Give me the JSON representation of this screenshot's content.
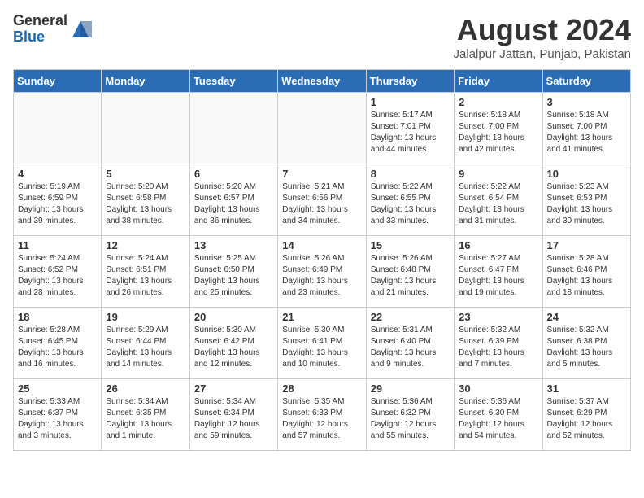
{
  "header": {
    "logo_general": "General",
    "logo_blue": "Blue",
    "month_title": "August 2024",
    "location": "Jalalpur Jattan, Punjab, Pakistan"
  },
  "weekdays": [
    "Sunday",
    "Monday",
    "Tuesday",
    "Wednesday",
    "Thursday",
    "Friday",
    "Saturday"
  ],
  "weeks": [
    [
      {
        "day": "",
        "info": ""
      },
      {
        "day": "",
        "info": ""
      },
      {
        "day": "",
        "info": ""
      },
      {
        "day": "",
        "info": ""
      },
      {
        "day": "1",
        "info": "Sunrise: 5:17 AM\nSunset: 7:01 PM\nDaylight: 13 hours\nand 44 minutes."
      },
      {
        "day": "2",
        "info": "Sunrise: 5:18 AM\nSunset: 7:00 PM\nDaylight: 13 hours\nand 42 minutes."
      },
      {
        "day": "3",
        "info": "Sunrise: 5:18 AM\nSunset: 7:00 PM\nDaylight: 13 hours\nand 41 minutes."
      }
    ],
    [
      {
        "day": "4",
        "info": "Sunrise: 5:19 AM\nSunset: 6:59 PM\nDaylight: 13 hours\nand 39 minutes."
      },
      {
        "day": "5",
        "info": "Sunrise: 5:20 AM\nSunset: 6:58 PM\nDaylight: 13 hours\nand 38 minutes."
      },
      {
        "day": "6",
        "info": "Sunrise: 5:20 AM\nSunset: 6:57 PM\nDaylight: 13 hours\nand 36 minutes."
      },
      {
        "day": "7",
        "info": "Sunrise: 5:21 AM\nSunset: 6:56 PM\nDaylight: 13 hours\nand 34 minutes."
      },
      {
        "day": "8",
        "info": "Sunrise: 5:22 AM\nSunset: 6:55 PM\nDaylight: 13 hours\nand 33 minutes."
      },
      {
        "day": "9",
        "info": "Sunrise: 5:22 AM\nSunset: 6:54 PM\nDaylight: 13 hours\nand 31 minutes."
      },
      {
        "day": "10",
        "info": "Sunrise: 5:23 AM\nSunset: 6:53 PM\nDaylight: 13 hours\nand 30 minutes."
      }
    ],
    [
      {
        "day": "11",
        "info": "Sunrise: 5:24 AM\nSunset: 6:52 PM\nDaylight: 13 hours\nand 28 minutes."
      },
      {
        "day": "12",
        "info": "Sunrise: 5:24 AM\nSunset: 6:51 PM\nDaylight: 13 hours\nand 26 minutes."
      },
      {
        "day": "13",
        "info": "Sunrise: 5:25 AM\nSunset: 6:50 PM\nDaylight: 13 hours\nand 25 minutes."
      },
      {
        "day": "14",
        "info": "Sunrise: 5:26 AM\nSunset: 6:49 PM\nDaylight: 13 hours\nand 23 minutes."
      },
      {
        "day": "15",
        "info": "Sunrise: 5:26 AM\nSunset: 6:48 PM\nDaylight: 13 hours\nand 21 minutes."
      },
      {
        "day": "16",
        "info": "Sunrise: 5:27 AM\nSunset: 6:47 PM\nDaylight: 13 hours\nand 19 minutes."
      },
      {
        "day": "17",
        "info": "Sunrise: 5:28 AM\nSunset: 6:46 PM\nDaylight: 13 hours\nand 18 minutes."
      }
    ],
    [
      {
        "day": "18",
        "info": "Sunrise: 5:28 AM\nSunset: 6:45 PM\nDaylight: 13 hours\nand 16 minutes."
      },
      {
        "day": "19",
        "info": "Sunrise: 5:29 AM\nSunset: 6:44 PM\nDaylight: 13 hours\nand 14 minutes."
      },
      {
        "day": "20",
        "info": "Sunrise: 5:30 AM\nSunset: 6:42 PM\nDaylight: 13 hours\nand 12 minutes."
      },
      {
        "day": "21",
        "info": "Sunrise: 5:30 AM\nSunset: 6:41 PM\nDaylight: 13 hours\nand 10 minutes."
      },
      {
        "day": "22",
        "info": "Sunrise: 5:31 AM\nSunset: 6:40 PM\nDaylight: 13 hours\nand 9 minutes."
      },
      {
        "day": "23",
        "info": "Sunrise: 5:32 AM\nSunset: 6:39 PM\nDaylight: 13 hours\nand 7 minutes."
      },
      {
        "day": "24",
        "info": "Sunrise: 5:32 AM\nSunset: 6:38 PM\nDaylight: 13 hours\nand 5 minutes."
      }
    ],
    [
      {
        "day": "25",
        "info": "Sunrise: 5:33 AM\nSunset: 6:37 PM\nDaylight: 13 hours\nand 3 minutes."
      },
      {
        "day": "26",
        "info": "Sunrise: 5:34 AM\nSunset: 6:35 PM\nDaylight: 13 hours\nand 1 minute."
      },
      {
        "day": "27",
        "info": "Sunrise: 5:34 AM\nSunset: 6:34 PM\nDaylight: 12 hours\nand 59 minutes."
      },
      {
        "day": "28",
        "info": "Sunrise: 5:35 AM\nSunset: 6:33 PM\nDaylight: 12 hours\nand 57 minutes."
      },
      {
        "day": "29",
        "info": "Sunrise: 5:36 AM\nSunset: 6:32 PM\nDaylight: 12 hours\nand 55 minutes."
      },
      {
        "day": "30",
        "info": "Sunrise: 5:36 AM\nSunset: 6:30 PM\nDaylight: 12 hours\nand 54 minutes."
      },
      {
        "day": "31",
        "info": "Sunrise: 5:37 AM\nSunset: 6:29 PM\nDaylight: 12 hours\nand 52 minutes."
      }
    ]
  ]
}
